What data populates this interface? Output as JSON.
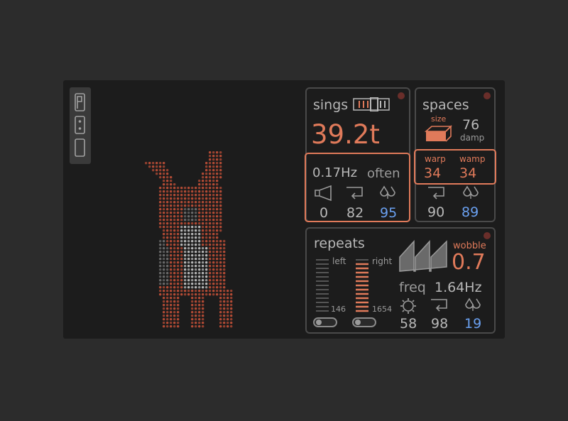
{
  "colors": {
    "accent": "#e07a5a",
    "blue": "#6aa0f0",
    "panel_border": "#4a4a4a",
    "bg": "#1c1c1c"
  },
  "sidebar": {
    "tools": [
      "p-icon",
      "dice-icon",
      "bar-icon"
    ]
  },
  "sings": {
    "title": "sings",
    "value": "39.2t",
    "rate": "0.17Hz",
    "rate_label": "often",
    "params": [
      "0",
      "82",
      "95"
    ]
  },
  "spaces": {
    "title": "spaces",
    "size_label": "size",
    "damp_value": "76",
    "damp_label": "damp",
    "warp_label": "warp",
    "warp_value": "34",
    "wamp_label": "wamp",
    "wamp_value": "34",
    "params": [
      "90",
      "89"
    ]
  },
  "repeats": {
    "title": "repeats",
    "left_label": "left",
    "left_value": "146",
    "right_label": "right",
    "right_value": "1654",
    "wobble_label": "wobble",
    "wobble_value": "0.7",
    "freq_label": "freq",
    "freq_value": "1.64Hz",
    "params": [
      "58",
      "98",
      "19"
    ]
  }
}
